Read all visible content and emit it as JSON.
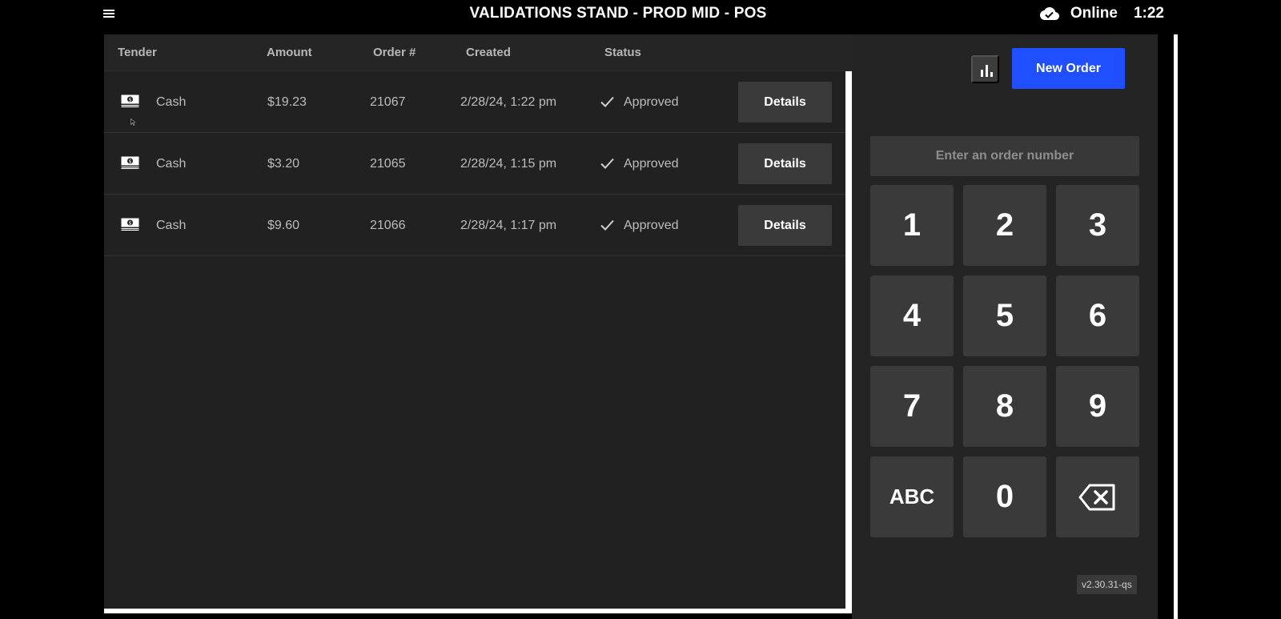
{
  "header": {
    "title": "VALIDATIONS STAND - PROD MID - POS",
    "connection_status": "Online",
    "time": "1:22"
  },
  "orders": {
    "columns": [
      "Tender",
      "Amount",
      "Order #",
      "Created",
      "Status"
    ],
    "rows": [
      {
        "tender": "Cash",
        "amount": "$19.23",
        "order_number": "21067",
        "created": "2/28/24, 1:22 pm",
        "status": "Approved",
        "action": "Details"
      },
      {
        "tender": "Cash",
        "amount": "$3.20",
        "order_number": "21065",
        "created": "2/28/24, 1:15 pm",
        "status": "Approved",
        "action": "Details"
      },
      {
        "tender": "Cash",
        "amount": "$9.60",
        "order_number": "21066",
        "created": "2/28/24, 1:17 pm",
        "status": "Approved",
        "action": "Details"
      }
    ]
  },
  "side": {
    "new_order_label": "New Order",
    "order_input_placeholder": "Enter an order number",
    "keypad": [
      "1",
      "2",
      "3",
      "4",
      "5",
      "6",
      "7",
      "8",
      "9",
      "ABC",
      "0"
    ],
    "version": "v2.30.31-qs"
  },
  "colors": {
    "accent": "#1f4fff",
    "panel_bg": "#212121",
    "key_bg": "#3a3a3a"
  }
}
